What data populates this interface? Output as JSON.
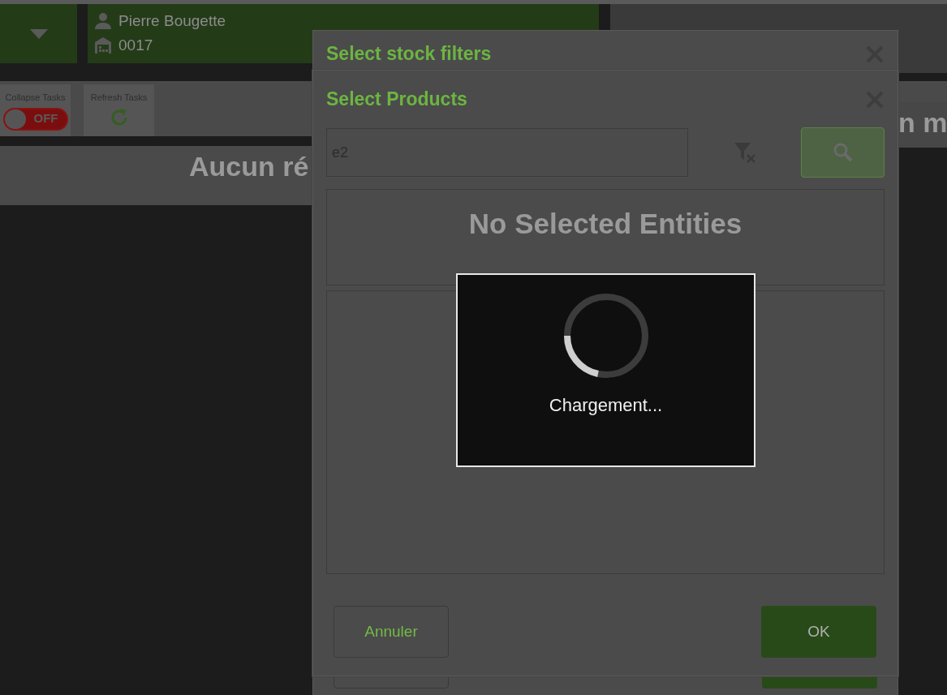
{
  "header": {
    "user_name": "Pierre Bougette",
    "store_code": "0017"
  },
  "toolbar": [
    {
      "kind": "toggle",
      "label": "Collapse Tasks",
      "on": false,
      "state_text": "OFF"
    },
    {
      "kind": "action",
      "label": "Refresh Tasks"
    }
  ],
  "right_partial_text": "n m",
  "empty_message": "Aucun ré",
  "back_dialog": {
    "title": "Select stock filters"
  },
  "dialog": {
    "title": "Select Products",
    "search": {
      "value": "e2"
    },
    "selection_panel": {
      "message": "No Selected Entities"
    },
    "buttons": [
      {
        "kind": "secondary",
        "label": "Annuler"
      },
      {
        "kind": "primary",
        "label": "OK"
      }
    ]
  },
  "loading": {
    "message": "Chargement..."
  }
}
